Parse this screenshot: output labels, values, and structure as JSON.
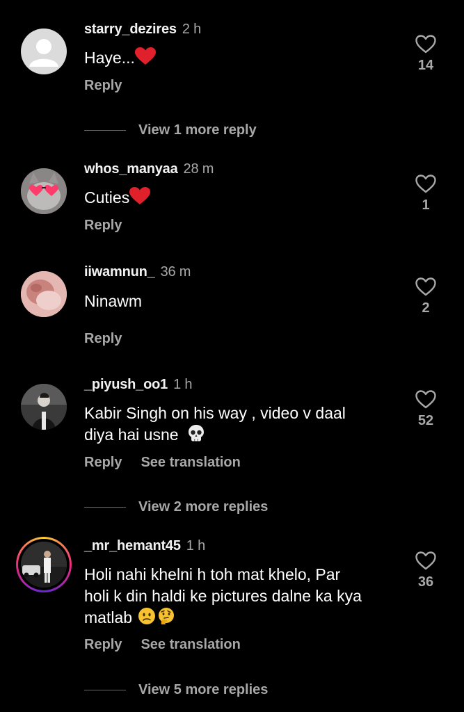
{
  "comments": [
    {
      "username": "starry_dezires",
      "time": "2 h",
      "text": "Haye...",
      "likes": "14",
      "reply": "Reply",
      "view_more": "View 1 more reply"
    },
    {
      "username": "whos_manyaa",
      "time": "28 m",
      "text": "Cuties",
      "likes": "1",
      "reply": "Reply"
    },
    {
      "username": "iiwamnun_",
      "time": "36 m",
      "text": "Ninawm",
      "likes": "2",
      "reply": "Reply"
    },
    {
      "username": "_piyush_oo1",
      "time": "1 h",
      "text_line1": "Kabir Singh on his way , video v daal",
      "text_line2": "diya hai usne",
      "likes": "52",
      "reply": "Reply",
      "see_translation": "See translation",
      "view_more": "View 2 more replies"
    },
    {
      "username": "_mr_hemant45",
      "time": "1 h",
      "text_line1": "Holi nahi khelni h toh mat khelo, Par",
      "text_line2": "holi k din haldi ke pictures dalne ka kya",
      "text_line3": "matlab",
      "likes": "36",
      "reply": "Reply",
      "see_translation": "See translation",
      "view_more": "View 5 more replies"
    }
  ],
  "icons": {
    "like": "heart-outline-icon",
    "heart_emoji": "red-heart-emoji",
    "skull_emoji": "skull-emoji",
    "confused_emoji": "confused-face-emoji",
    "thinking_emoji": "thinking-face-emoji"
  }
}
